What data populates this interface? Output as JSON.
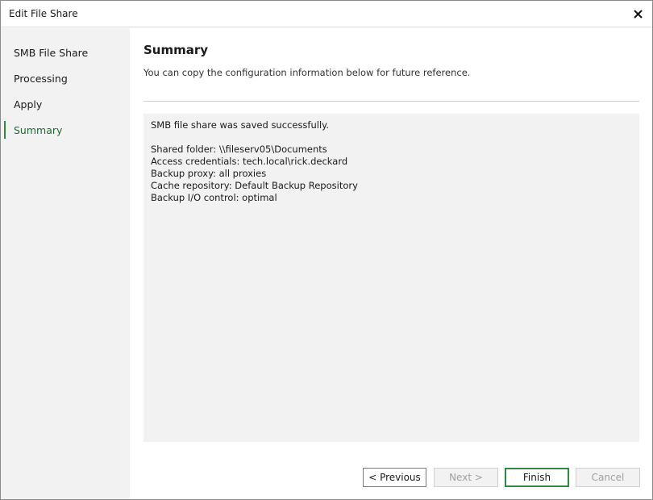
{
  "window": {
    "title": "Edit File Share"
  },
  "sidebar": {
    "items": [
      {
        "label": "SMB File Share"
      },
      {
        "label": "Processing"
      },
      {
        "label": "Apply"
      },
      {
        "label": "Summary"
      }
    ],
    "active_index": 3
  },
  "main": {
    "heading": "Summary",
    "subtext": "You can copy the configuration information below for future reference.",
    "summary": {
      "status": "SMB file share was saved successfully.",
      "details": [
        "Shared folder: \\\\fileserv05\\Documents",
        "Access credentials: tech.local\\rick.deckard",
        "Backup proxy: all proxies",
        "Cache repository: Default Backup Repository",
        "Backup I/O control: optimal"
      ]
    }
  },
  "buttons": {
    "previous": "< Previous",
    "next": "Next >",
    "finish": "Finish",
    "cancel": "Cancel"
  },
  "colors": {
    "accent": "#2e8b3e",
    "active_text": "#1e6b2f",
    "sidebar_bg": "#f1f2f1",
    "summary_bg": "#f1f2f1"
  },
  "icons": {
    "close": "close-icon"
  }
}
